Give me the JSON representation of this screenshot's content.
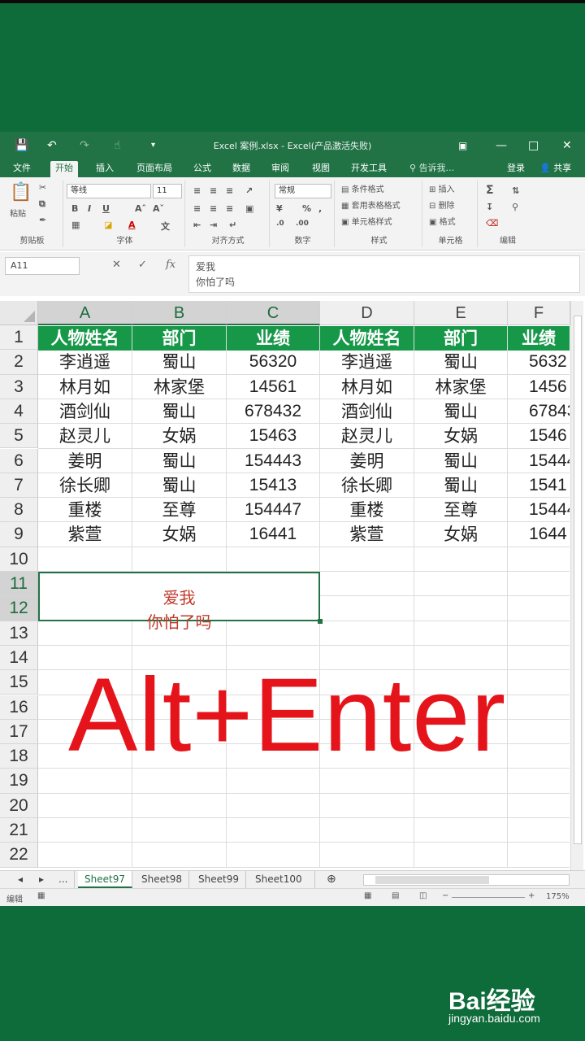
{
  "window": {
    "title": "Excel 案例.xlsx - Excel(产品激活失败)",
    "login": "登录",
    "share": "共享",
    "tell_me": "告诉我..."
  },
  "ribbon_tabs": [
    "文件",
    "开始",
    "插入",
    "页面布局",
    "公式",
    "数据",
    "审阅",
    "视图",
    "开发工具"
  ],
  "ribbon": {
    "clipboard_label": "剪贴板",
    "paste": "粘贴",
    "font_label": "字体",
    "font_name": "等线",
    "font_size": "11",
    "align_label": "对齐方式",
    "number_label": "数字",
    "number_format": "常规",
    "styles_label": "样式",
    "cond_format": "条件格式",
    "table_format": "套用表格格式",
    "cell_styles": "单元格样式",
    "cells_label": "单元格",
    "insert": "插入",
    "delete": "删除",
    "format": "格式",
    "editing_label": "编辑"
  },
  "formula_bar": {
    "name_box": "A11",
    "line1": "爱我",
    "line2": "你怕了吗"
  },
  "columns": [
    "A",
    "B",
    "C",
    "D",
    "E",
    "F"
  ],
  "rows": [
    "1",
    "2",
    "3",
    "4",
    "5",
    "6",
    "7",
    "8",
    "9",
    "10",
    "11",
    "12",
    "13",
    "14",
    "15",
    "16",
    "17",
    "18",
    "19",
    "20",
    "21",
    "22"
  ],
  "table": {
    "headers": [
      "人物姓名",
      "部门",
      "业绩",
      "人物姓名",
      "部门",
      "业绩"
    ],
    "data": [
      [
        "李逍遥",
        "蜀山",
        "56320",
        "李逍遥",
        "蜀山",
        "5632"
      ],
      [
        "林月如",
        "林家堡",
        "14561",
        "林月如",
        "林家堡",
        "1456"
      ],
      [
        "酒剑仙",
        "蜀山",
        "678432",
        "酒剑仙",
        "蜀山",
        "67843"
      ],
      [
        "赵灵儿",
        "女娲",
        "15463",
        "赵灵儿",
        "女娲",
        "1546"
      ],
      [
        "姜明",
        "蜀山",
        "154443",
        "姜明",
        "蜀山",
        "15444"
      ],
      [
        "徐长卿",
        "蜀山",
        "15413",
        "徐长卿",
        "蜀山",
        "1541"
      ],
      [
        "重楼",
        "至尊",
        "154447",
        "重楼",
        "至尊",
        "15444"
      ],
      [
        "紫萱",
        "女娲",
        "16441",
        "紫萱",
        "女娲",
        "1644"
      ]
    ]
  },
  "merged_cell": {
    "line1": "爱我",
    "line2": "你怕了吗"
  },
  "overlay_text": "Alt+Enter",
  "sheet_tabs": [
    "...",
    "Sheet97",
    "Sheet98",
    "Sheet99",
    "Sheet100"
  ],
  "status": {
    "mode": "编辑",
    "zoom": "175%"
  },
  "watermark": {
    "logo": "Bai经验",
    "url": "jingyan.baidu.com"
  }
}
